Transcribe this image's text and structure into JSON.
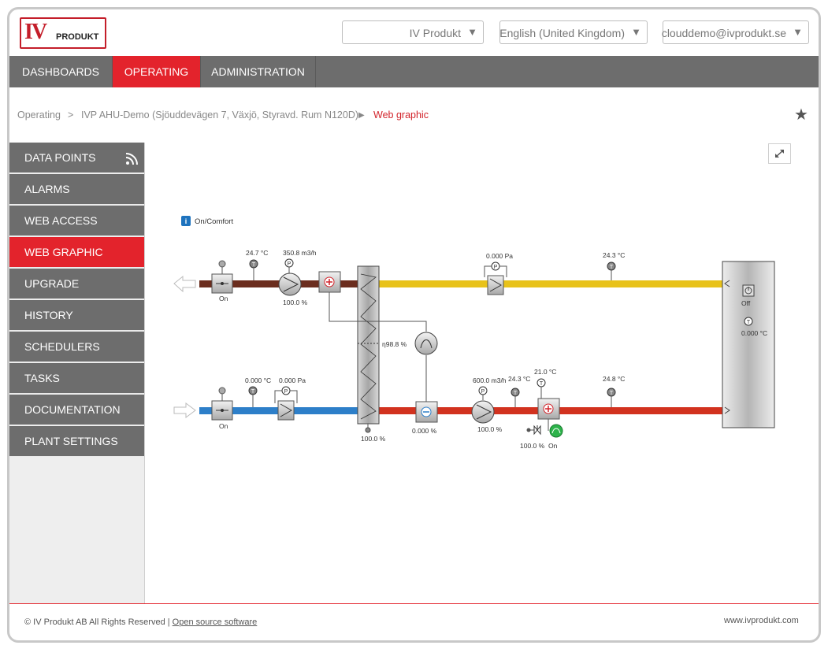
{
  "header": {
    "logo_text_iv": "IV",
    "logo_text_produkt": "PRODUKT",
    "org_select": "IV Produkt",
    "language_select": "English (United Kingdom)",
    "user_select": "clouddemo@ivprodukt.se"
  },
  "nav": {
    "tabs": [
      {
        "label": "DASHBOARDS",
        "active": false
      },
      {
        "label": "OPERATING",
        "active": true
      },
      {
        "label": "ADMINISTRATION",
        "active": false
      }
    ]
  },
  "breadcrumb": {
    "level1": "Operating",
    "sep1": ">",
    "level2": "IVP AHU-Demo (Sjöuddevägen 7, Växjö, Styravd. Rum N120D)",
    "sep2": "▶",
    "current": "Web graphic"
  },
  "sidebar": {
    "items": [
      {
        "label": "DATA POINTS"
      },
      {
        "label": "ALARMS"
      },
      {
        "label": "WEB ACCESS"
      },
      {
        "label": "WEB GRAPHIC",
        "active": true
      },
      {
        "label": "UPGRADE"
      },
      {
        "label": "HISTORY"
      },
      {
        "label": "SCHEDULERS"
      },
      {
        "label": "TASKS"
      },
      {
        "label": "DOCUMENTATION"
      },
      {
        "label": "PLANT SETTINGS"
      }
    ]
  },
  "graphic": {
    "status_icon": "i",
    "status": "On/Comfort",
    "exhaust_temp": "24.7 °C",
    "exhaust_flow": "350.8 m3/h",
    "exhaust_damper_state": "On",
    "exhaust_fan_speed": "100.0 %",
    "supply_filter_pressure": "0.000 Pa",
    "extract_temp": "24.3 °C",
    "unit_status": "Off",
    "room_temp": "0.000 °C",
    "heat_recovery_eff": "η98.8 %",
    "outdoor_temp": "0.000 °C",
    "outdoor_filter_pressure": "0.000 Pa",
    "outdoor_damper_state": "On",
    "exchanger_output": "100.0 %",
    "cooler_output": "0.000 %",
    "supply_flow": "600.0 m3/h",
    "supply_fan_speed": "100.0 %",
    "after_fan_temp": "24.3 °C",
    "heater_temp": "21.0 °C",
    "valve_output": "100.0 %",
    "pump_state": "On",
    "supply_temp": "24.8 °C",
    "sensor_T": "T",
    "sensor_P": "P"
  },
  "colors": {
    "accent": "#e3232c",
    "nav_bg": "#6d6d6d",
    "duct_brown": "#6b2d1e",
    "duct_yellow": "#e8c21a",
    "duct_blue": "#2d7fc9",
    "duct_red": "#d2321f"
  },
  "footer": {
    "copyright": "© IV Produkt AB All Rights Reserved |",
    "open_source": "Open source software",
    "website": "www.ivprodukt.com"
  }
}
